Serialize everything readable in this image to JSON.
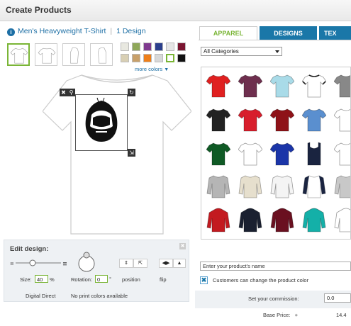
{
  "header": {
    "title": "Create Products"
  },
  "product": {
    "name": "Men's Heavyweight T-Shirt",
    "designs": "1 Design"
  },
  "views": [
    "front",
    "back",
    "left-sleeve",
    "right-sleeve"
  ],
  "colors": {
    "row1": [
      "#e8e8e0",
      "#8fa85a",
      "#7f3a8f",
      "#2b3f8c",
      "#e5e5e5",
      "#7a1530"
    ],
    "row2": [
      "#d8cfb4",
      "#c8a06a",
      "#ee7f1a",
      "#d8d8d8",
      "#ffffff",
      "#111111"
    ],
    "more_label": "more colors",
    "accent": "#7ab536",
    "brand": "#1a77a8"
  },
  "edit": {
    "title": "Edit design:",
    "size_label": "Size:",
    "size_value": "40",
    "size_unit": "%",
    "rotation_label": "Rotation:",
    "rotation_value": "0",
    "rotation_unit": "°",
    "position_label": "position",
    "flip_label": "flip",
    "method": "Digital Direct",
    "print_note": "No print colors available"
  },
  "tabs": [
    "APPAREL",
    "DESIGNS",
    "TEX"
  ],
  "category": {
    "selected": "All Categories"
  },
  "catalog": [
    {
      "color": "#e02020",
      "kind": "tee"
    },
    {
      "color": "#6e2f4e",
      "kind": "tee"
    },
    {
      "color": "#a9dbe8",
      "kind": "tee"
    },
    {
      "color": "#ffffff",
      "kind": "ringer"
    },
    {
      "color": "#888888",
      "kind": "tee"
    },
    {
      "color": "#222222",
      "kind": "tee"
    },
    {
      "color": "#d81e2c",
      "kind": "tee"
    },
    {
      "color": "#8e1218",
      "kind": "tee"
    },
    {
      "color": "#5a8fcf",
      "kind": "tee"
    },
    {
      "color": "#ffffff",
      "kind": "tee"
    },
    {
      "color": "#0f5a25",
      "kind": "tee"
    },
    {
      "color": "#ffffff",
      "kind": "tee"
    },
    {
      "color": "#1b35a8",
      "kind": "tee"
    },
    {
      "color": "#1a2440",
      "kind": "tank"
    },
    {
      "color": "#ffffff",
      "kind": "tee"
    },
    {
      "color": "#b5b5b5",
      "kind": "sweat"
    },
    {
      "color": "#e6dfcd",
      "kind": "sweat"
    },
    {
      "color": "#f4f4f4",
      "kind": "long"
    },
    {
      "color": "#1a2440",
      "kind": "raglan"
    },
    {
      "color": "#c8c8c8",
      "kind": "sweat"
    },
    {
      "color": "#c31a20",
      "kind": "hoodie"
    },
    {
      "color": "#1a2030",
      "kind": "hoodie"
    },
    {
      "color": "#6a1020",
      "kind": "hoodie"
    },
    {
      "color": "#14b0a8",
      "kind": "hoodie"
    },
    {
      "color": "#ffffff",
      "kind": "hoodie"
    }
  ],
  "form": {
    "name_placeholder": "Enter your product's name",
    "customers_label": "Customers can change the product color",
    "commission_label": "Set your commission:",
    "commission_value": "0.0",
    "base_label": "Base Price:",
    "base_sign": "+",
    "base_value": "14.4"
  }
}
